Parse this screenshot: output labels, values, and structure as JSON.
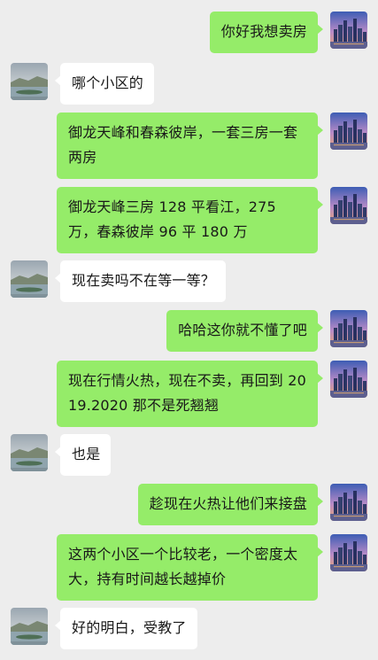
{
  "messages": [
    {
      "from": "me",
      "text": "你好我想卖房"
    },
    {
      "from": "them",
      "text": "哪个小区的"
    },
    {
      "from": "me",
      "text": "御龙天峰和春森彼岸，一套三房一套两房"
    },
    {
      "from": "me",
      "text": "御龙天峰三房 128 平看江，275 万，春森彼岸 96 平 180 万"
    },
    {
      "from": "them",
      "text": "现在卖吗不在等一等？"
    },
    {
      "from": "me",
      "text": "哈哈这你就不懂了吧"
    },
    {
      "from": "me",
      "text": "现在行情火热，现在不卖，再回到 2019.2020 那不是死翘翘"
    },
    {
      "from": "them",
      "text": "也是"
    },
    {
      "from": "me",
      "text": "趁现在火热让他们来接盘"
    },
    {
      "from": "me",
      "text": "这两个小区一个比较老，一个密度太大，持有时间越长越掉价"
    },
    {
      "from": "them",
      "text": "好的明白，受教了"
    }
  ],
  "avatars": {
    "me": "city-skyline-avatar",
    "them": "lake-landscape-avatar"
  },
  "colors": {
    "background": "#ededed",
    "my_bubble": "#95ec69",
    "their_bubble": "#ffffff"
  }
}
